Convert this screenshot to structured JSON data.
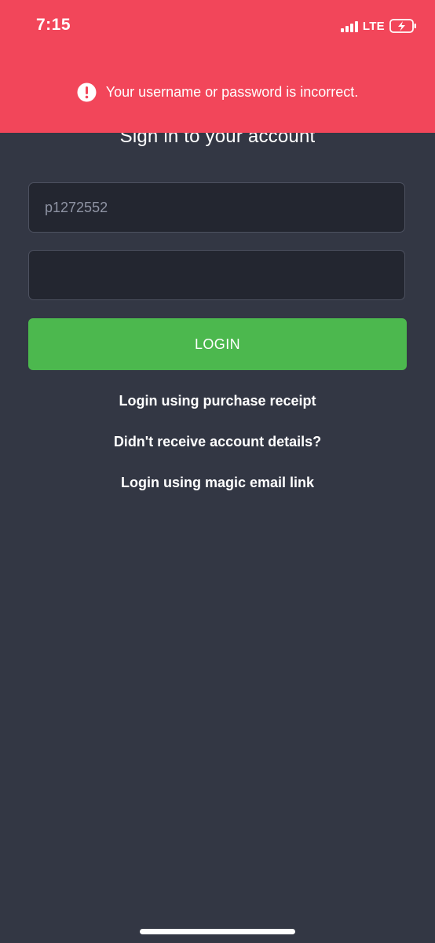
{
  "status_bar": {
    "time": "7:15",
    "network": "LTE",
    "signal_icon": "cellular-signal-icon",
    "battery_icon": "battery-charging-icon"
  },
  "error_banner": {
    "icon": "exclamation-circle-icon",
    "message": "Your username or password is incorrect.",
    "color": "#f2465a"
  },
  "form": {
    "title": "Sign in to your account",
    "username_value": "p1272552",
    "password_value": "",
    "login_label": "LOGIN",
    "login_color": "#4cb84e"
  },
  "links": {
    "purchase_receipt": "Login using purchase receipt",
    "account_details": "Didn't receive account details?",
    "magic_link": "Login using magic email link"
  },
  "colors": {
    "background": "#333744",
    "field_background": "#232630"
  }
}
